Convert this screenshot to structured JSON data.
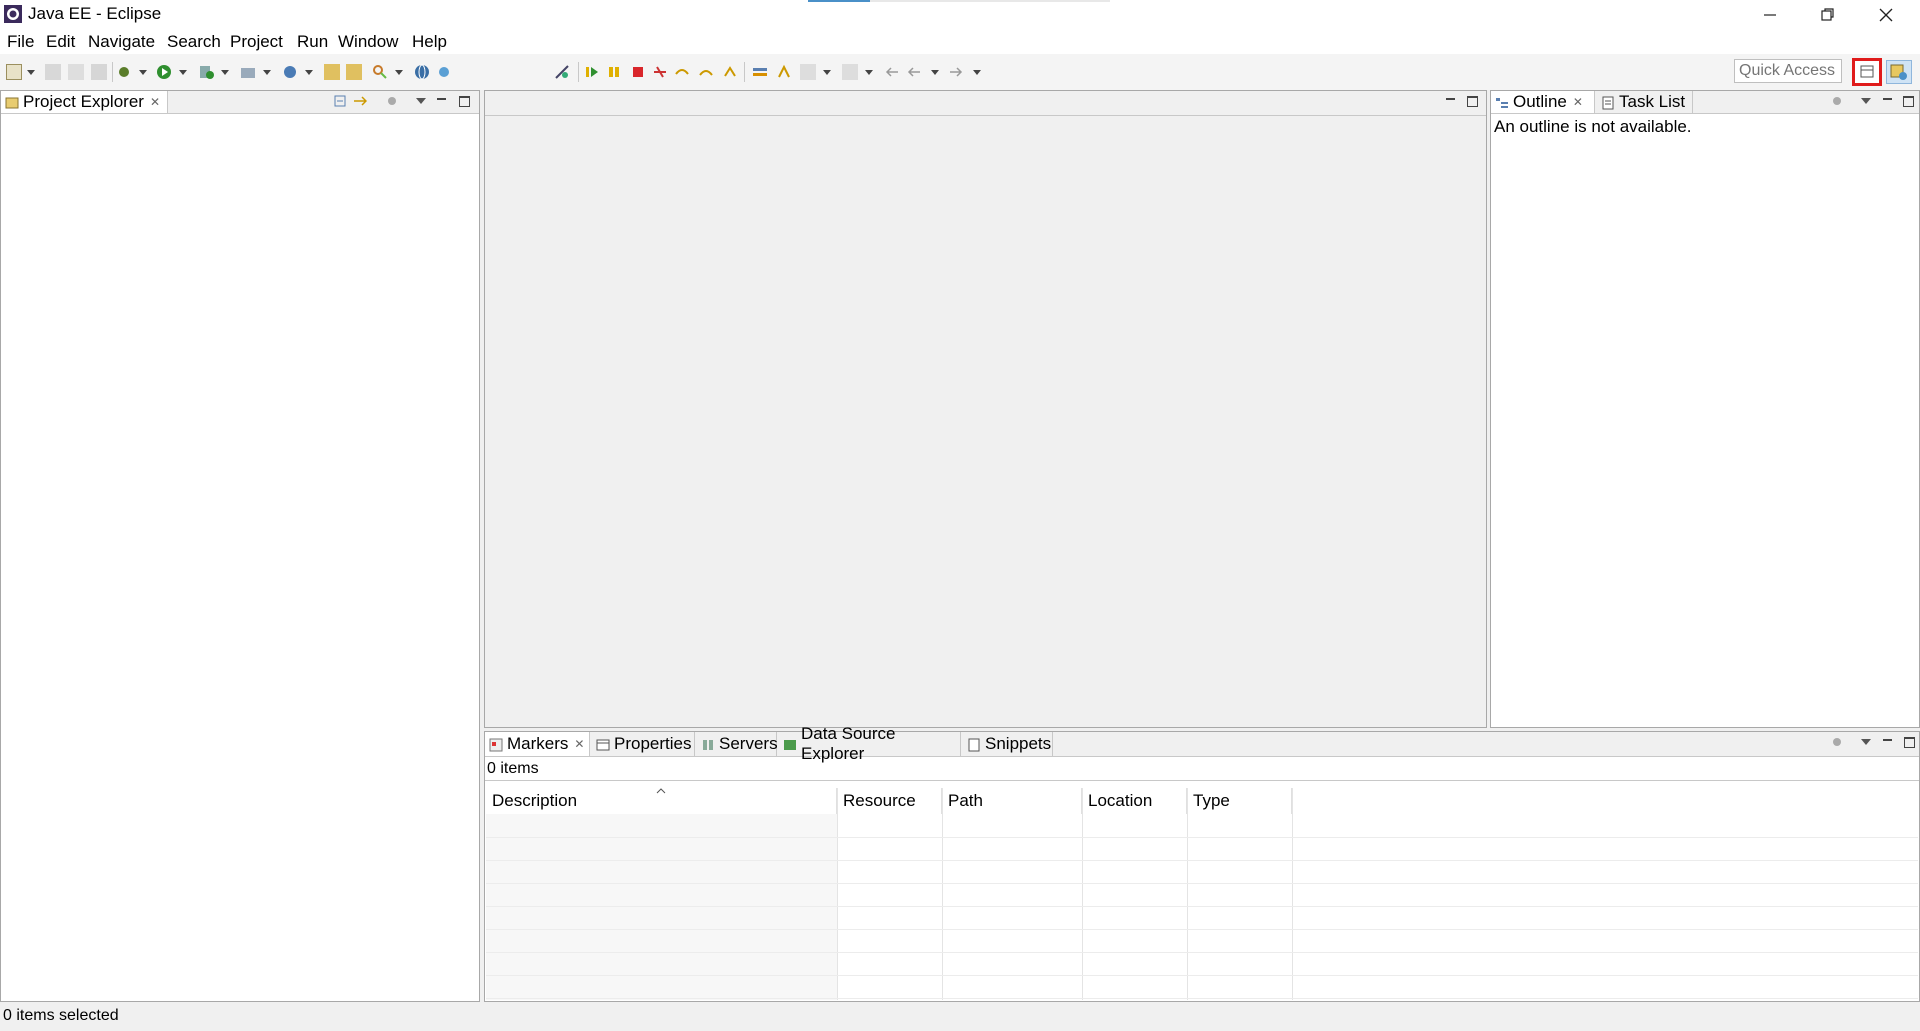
{
  "window": {
    "title": "Java EE - Eclipse"
  },
  "menu": {
    "items": [
      "File",
      "Edit",
      "Navigate",
      "Search",
      "Project",
      "Run",
      "Window",
      "Help"
    ]
  },
  "toolbar": {
    "quick_access_placeholder": "Quick Access"
  },
  "project_explorer": {
    "tab_label": "Project Explorer"
  },
  "outline": {
    "tab_label": "Outline",
    "task_list_label": "Task List",
    "message": "An outline is not available."
  },
  "bottom": {
    "tabs": [
      "Markers",
      "Properties",
      "Servers",
      "Data Source Explorer",
      "Snippets"
    ],
    "items_count": "0 items",
    "columns": [
      "Description",
      "Resource",
      "Path",
      "Location",
      "Type"
    ]
  },
  "status": {
    "text": "0 items selected"
  },
  "colors": {
    "highlight_border": "#e01b1b",
    "accent": "#4a90c8"
  }
}
